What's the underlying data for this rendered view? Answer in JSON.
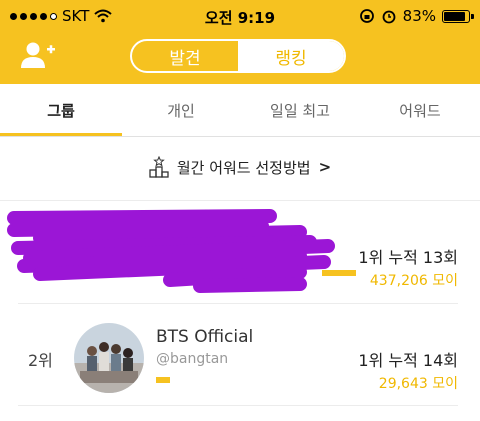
{
  "status_bar": {
    "carrier": "SKT",
    "time": "오전 9:19",
    "battery": "83%"
  },
  "header": {
    "add_user_icon": "add-friend-icon",
    "segments": [
      {
        "label": "발견",
        "active": false
      },
      {
        "label": "랭킹",
        "active": true
      }
    ]
  },
  "tabs": [
    {
      "label": "그룹",
      "active": true
    },
    {
      "label": "개인",
      "active": false
    },
    {
      "label": "일일 최고",
      "active": false
    },
    {
      "label": "어워드",
      "active": false
    }
  ],
  "award_link": {
    "label": "월간 어워드 선정방법",
    "chevron": ">"
  },
  "rows": [
    {
      "rank": "1위",
      "count": "1위 누적 13회",
      "amount": "437,206 모이",
      "redacted": true
    },
    {
      "rank": "2위",
      "name": "BTS Official",
      "handle": "@bangtan",
      "count": "1위 누적 14회",
      "amount": "29,643 모이"
    }
  ],
  "colors": {
    "brand_yellow": "#f6c220",
    "amount_yellow": "#f0b800",
    "redaction": "#9b16d6"
  }
}
